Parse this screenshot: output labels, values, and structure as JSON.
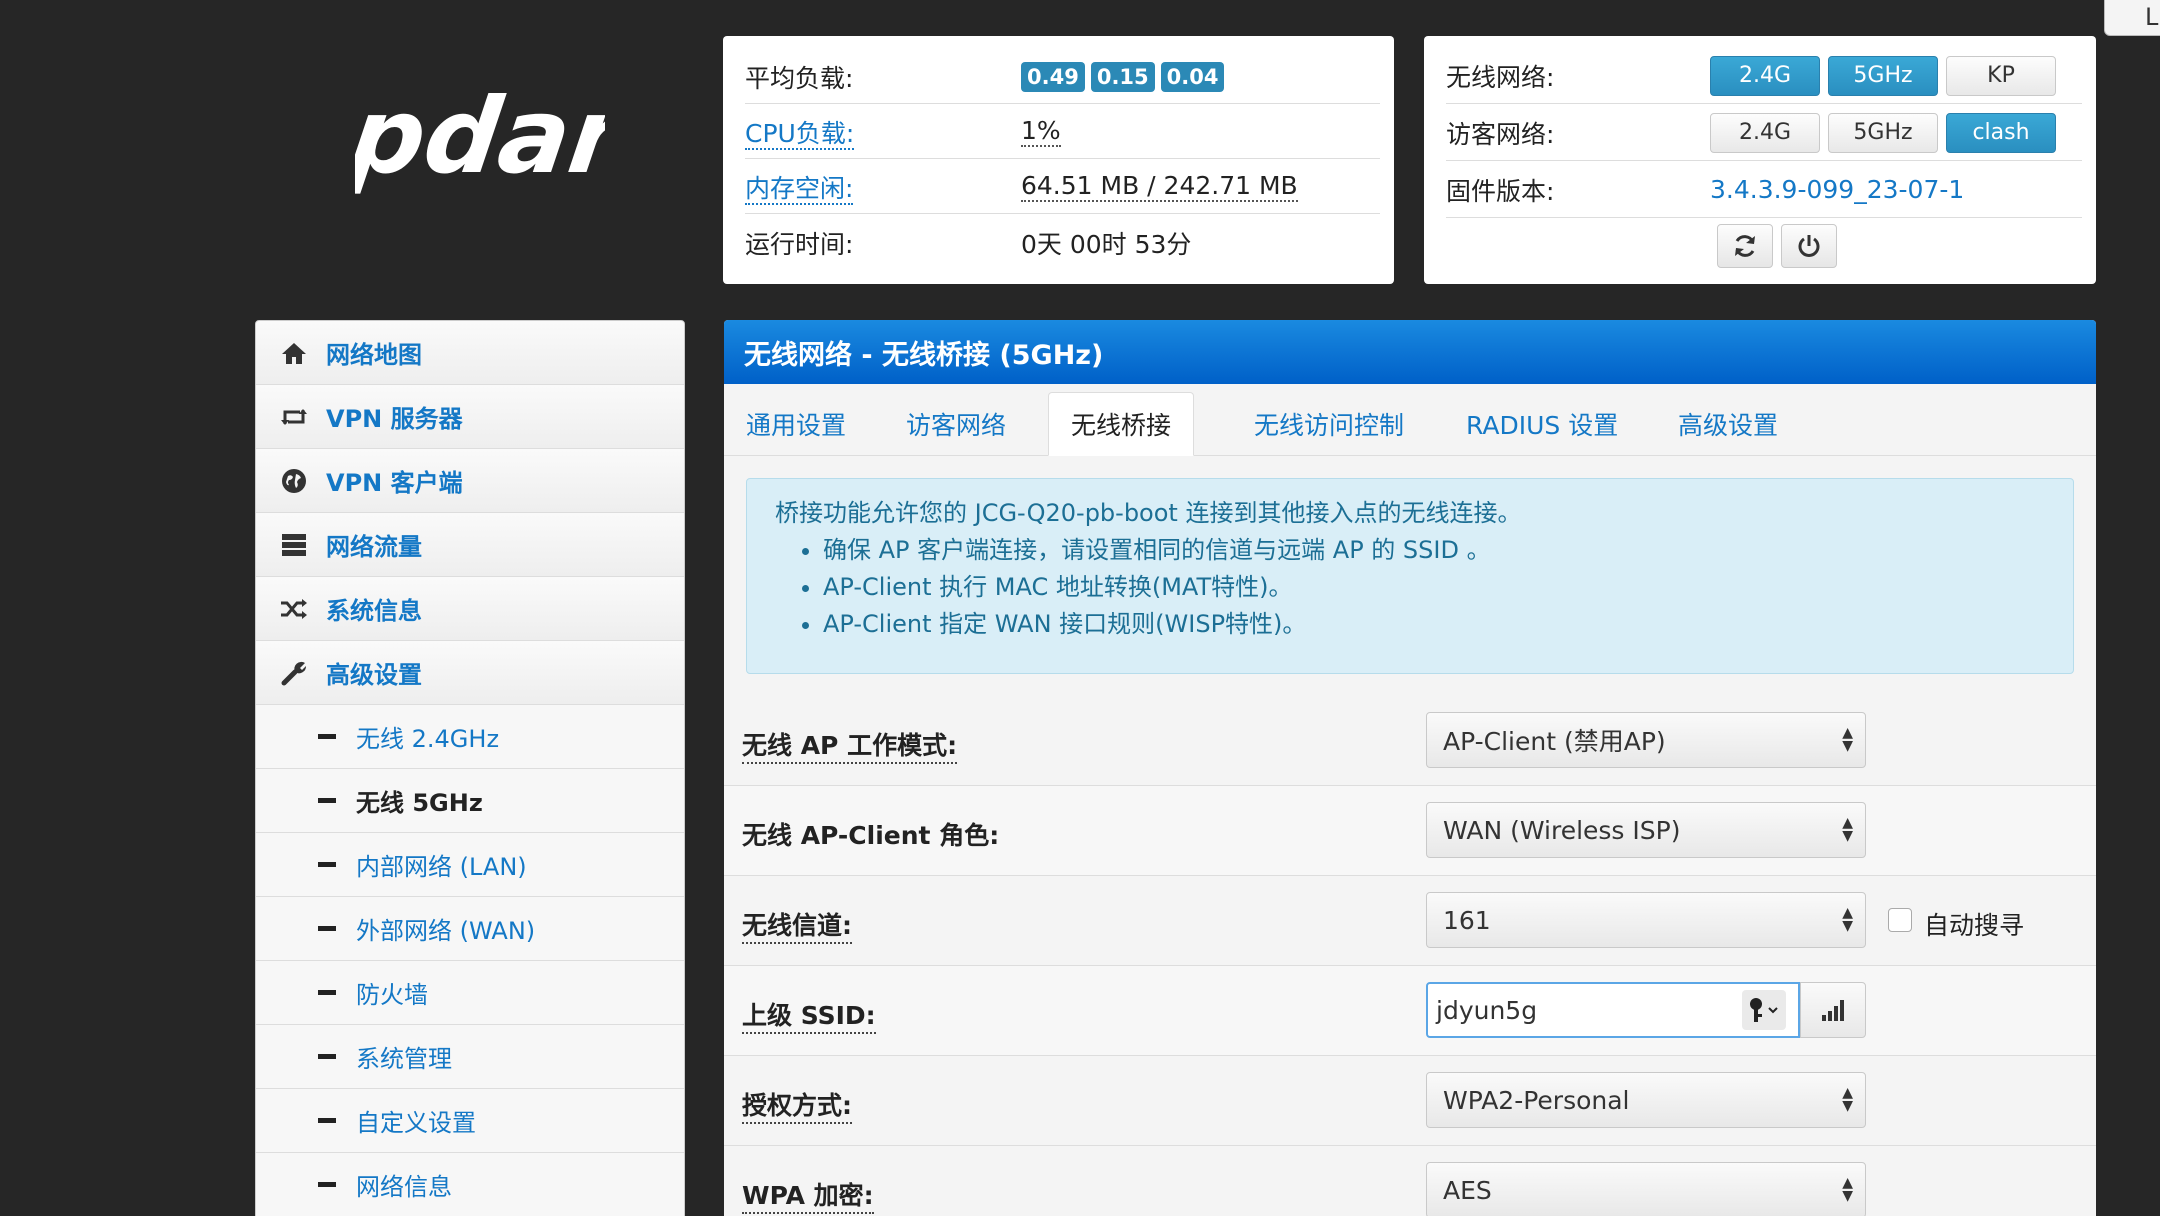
{
  "logout_tab": "L",
  "logo_text": "pdan",
  "status": {
    "load_label": "平均负载:",
    "load_values": [
      "0.49",
      "0.15",
      "0.04"
    ],
    "cpu_label": "CPU负载:",
    "cpu_value": "1%",
    "mem_label": "内存空闲:",
    "mem_value": "64.51 MB / 242.71 MB",
    "uptime_label": "运行时间:",
    "uptime_value": "0天 00时 53分"
  },
  "wireless": {
    "wifi_label": "无线网络:",
    "wifi_buttons": [
      "2.4G",
      "5GHz",
      "KP"
    ],
    "guest_label": "访客网络:",
    "guest_buttons": [
      "2.4G",
      "5GHz",
      "clash"
    ],
    "fw_label": "固件版本:",
    "fw_value": "3.4.3.9-099_23-07-1"
  },
  "sidebar": {
    "items": [
      {
        "label": "网络地图",
        "icon": "home-icon"
      },
      {
        "label": "VPN 服务器",
        "icon": "retweet-icon"
      },
      {
        "label": "VPN 客户端",
        "icon": "globe-icon"
      },
      {
        "label": "网络流量",
        "icon": "server-icon"
      },
      {
        "label": "系统信息",
        "icon": "shuffle-icon"
      },
      {
        "label": "高级设置",
        "icon": "wrench-icon"
      }
    ],
    "subitems": [
      {
        "label": "无线 2.4GHz"
      },
      {
        "label": "无线 5GHz"
      },
      {
        "label": "内部网络 (LAN)"
      },
      {
        "label": "外部网络 (WAN)"
      },
      {
        "label": "防火墙"
      },
      {
        "label": "系统管理"
      },
      {
        "label": "自定义设置"
      },
      {
        "label": "网络信息"
      }
    ]
  },
  "main": {
    "title": "无线网络 - 无线桥接 (5GHz)",
    "tabs": [
      "通用设置",
      "访客网络",
      "无线桥接",
      "无线访问控制",
      "RADIUS 设置",
      "高级设置"
    ],
    "info": {
      "intro": "桥接功能允许您的 JCG-Q20-pb-boot 连接到其他接入点的无线连接。",
      "bullets": [
        "确保 AP 客户端连接，请设置相同的信道与远端 AP 的 SSID 。",
        "AP-Client 执行 MAC 地址转换(MAT特性)。",
        "AP-Client 指定 WAN 接口规则(WISP特性)。"
      ]
    },
    "form": {
      "ap_mode_label": "无线 AP 工作模式:",
      "ap_mode_value": "AP-Client (禁用AP)",
      "role_label": "无线 AP-Client 角色:",
      "role_value": "WAN (Wireless ISP)",
      "channel_label": "无线信道:",
      "channel_value": "161",
      "auto_scan_label": "自动搜寻",
      "ssid_label": "上级 SSID:",
      "ssid_value": "jdyun5g",
      "auth_label": "授权方式:",
      "auth_value": "WPA2-Personal",
      "wpa_label": "WPA 加密:",
      "wpa_value": "AES"
    }
  }
}
